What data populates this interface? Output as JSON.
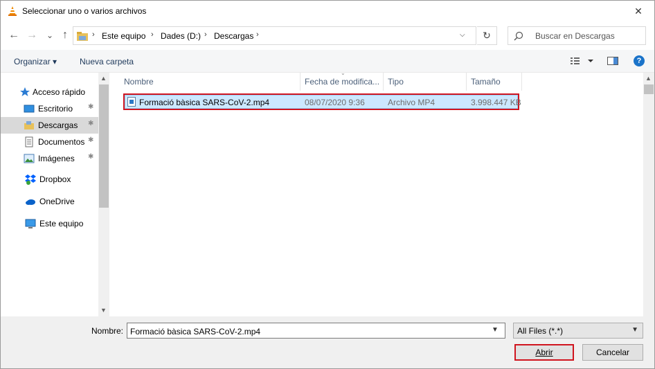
{
  "window": {
    "title": "Seleccionar uno o varios archivos",
    "close_glyph": "✕",
    "title_icon": "vlc-cone-icon"
  },
  "address": {
    "back_glyph": "←",
    "forward_glyph": "→",
    "recent_glyph": "⌄",
    "up_glyph": "↑",
    "crumbs": [
      "Este equipo",
      "Dades (D:)",
      "Descargas"
    ],
    "separator": "›",
    "dropdown_glyph": "⌵",
    "refresh_glyph": "↻",
    "search_placeholder": "Buscar en Descargas"
  },
  "toolbar": {
    "organize_label": "Organizar ▾",
    "new_folder_label": "Nueva carpeta",
    "help_label": "?"
  },
  "nav": {
    "items": [
      {
        "label": "Acceso rápido",
        "icon": "star-icon",
        "pinned": false
      },
      {
        "label": "Escritorio",
        "icon": "desktop-icon",
        "pinned": true
      },
      {
        "label": "Descargas",
        "icon": "downloads-icon",
        "pinned": true,
        "selected": true
      },
      {
        "label": "Documentos",
        "icon": "documents-icon",
        "pinned": true
      },
      {
        "label": "Imágenes",
        "icon": "pictures-icon",
        "pinned": true
      },
      {
        "label": "Dropbox",
        "icon": "dropbox-icon",
        "pinned": false
      },
      {
        "label": "OneDrive",
        "icon": "onedrive-icon",
        "pinned": false
      },
      {
        "label": "Este equipo",
        "icon": "computer-icon",
        "pinned": false
      }
    ],
    "pin_glyph": "📌"
  },
  "columns": [
    "Nombre",
    "Fecha de modifica...",
    "Tipo",
    "Tamaño"
  ],
  "files": [
    {
      "name": "Formació bàsica SARS-CoV-2.mp4",
      "date": "08/07/2020 9:36",
      "type": "Archivo MP4",
      "size": "3.998.447 KB",
      "selected": true
    }
  ],
  "bottom": {
    "filename_label": "Nombre:",
    "filename_value": "Formació bàsica SARS-CoV-2.mp4",
    "filter_value": "All Files (*.*)",
    "open_label": "Abrir",
    "cancel_label": "Cancelar"
  },
  "colors": {
    "highlight_border": "#d0141e",
    "selection_bg": "#cce8ff",
    "accent": "#1a73c9"
  }
}
